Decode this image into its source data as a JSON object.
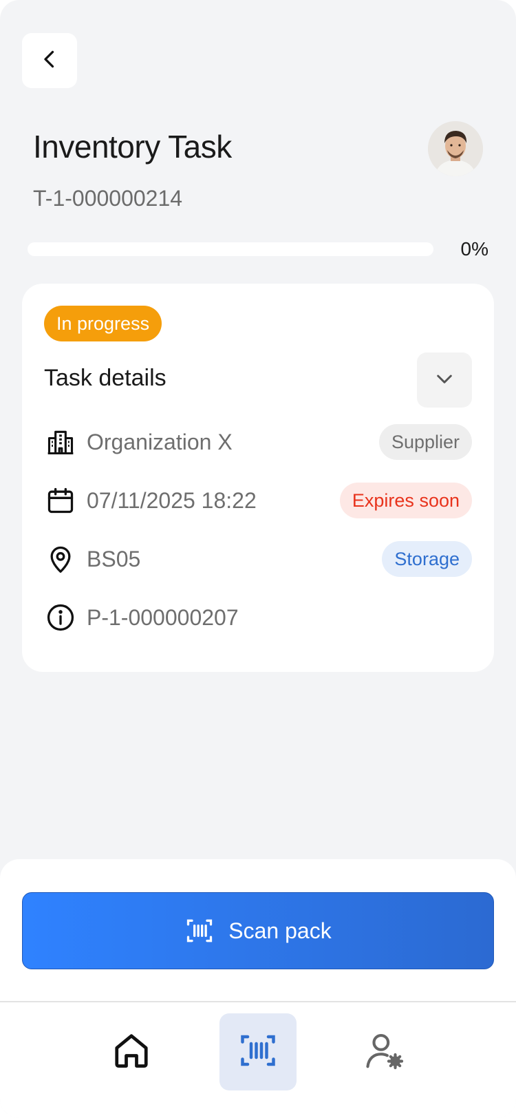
{
  "header": {
    "title": "Inventory Task",
    "task_id": "T-1-000000214"
  },
  "progress": {
    "value": 0,
    "label": "0%"
  },
  "card": {
    "status": "In progress",
    "section_title": "Task details",
    "rows": [
      {
        "icon": "building-icon",
        "text": "Organization X",
        "tag": "Supplier"
      },
      {
        "icon": "calendar-icon",
        "text": "07/11/2025 18:22",
        "tag": "Expires soon"
      },
      {
        "icon": "location-pin-icon",
        "text": "BS05",
        "tag": "Storage"
      },
      {
        "icon": "info-icon",
        "text": "P-1-000000207",
        "tag": ""
      }
    ]
  },
  "actions": {
    "scan_label": "Scan pack"
  },
  "nav": {
    "items": [
      {
        "icon": "home-icon",
        "active": false
      },
      {
        "icon": "barcode-scan-icon",
        "active": true
      },
      {
        "icon": "user-settings-icon",
        "active": false
      }
    ]
  },
  "colors": {
    "accent": "#2f80ff",
    "status_in_progress": "#f59e0b",
    "expires_soon": "#e8331c",
    "storage": "#2f6fcf",
    "background": "#f3f4f6"
  }
}
